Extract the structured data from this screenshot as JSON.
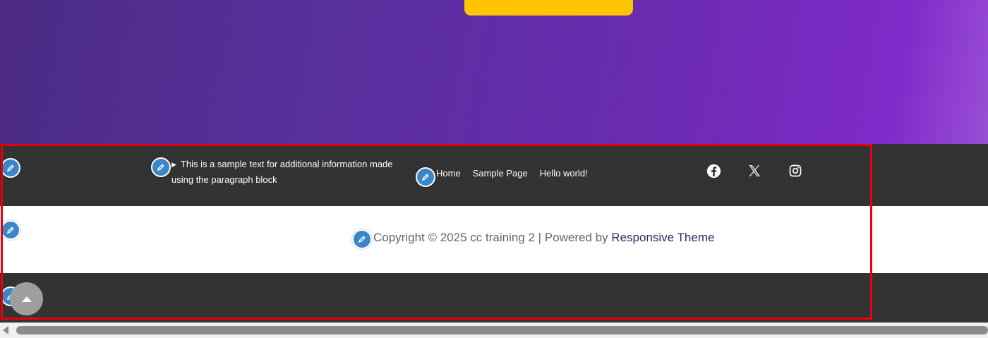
{
  "hero": {
    "background_start": "#4b2a84",
    "background_end": "#8a3acf",
    "button_color": "#ffc400"
  },
  "footer": {
    "top_bar_color": "#333333",
    "info": {
      "marker": "▶",
      "text": "This is a sample text for additional information made using the paragraph block"
    },
    "menu": [
      "Home",
      "Sample Page",
      "Hello world!"
    ],
    "social": [
      {
        "name": "facebook-icon"
      },
      {
        "name": "x-icon"
      },
      {
        "name": "instagram-icon"
      }
    ],
    "copyright": {
      "prefix": "Copyright © 2025 cc training 2 | Powered by ",
      "link": "Responsive Theme",
      "link_color": "#3b1f6e"
    }
  },
  "editor": {
    "pencil_icon": "pencil-icon",
    "pencil_color": "#3a86c8",
    "selection_color": "#e8000c"
  },
  "scroll_top_icon": "caret-up-icon"
}
